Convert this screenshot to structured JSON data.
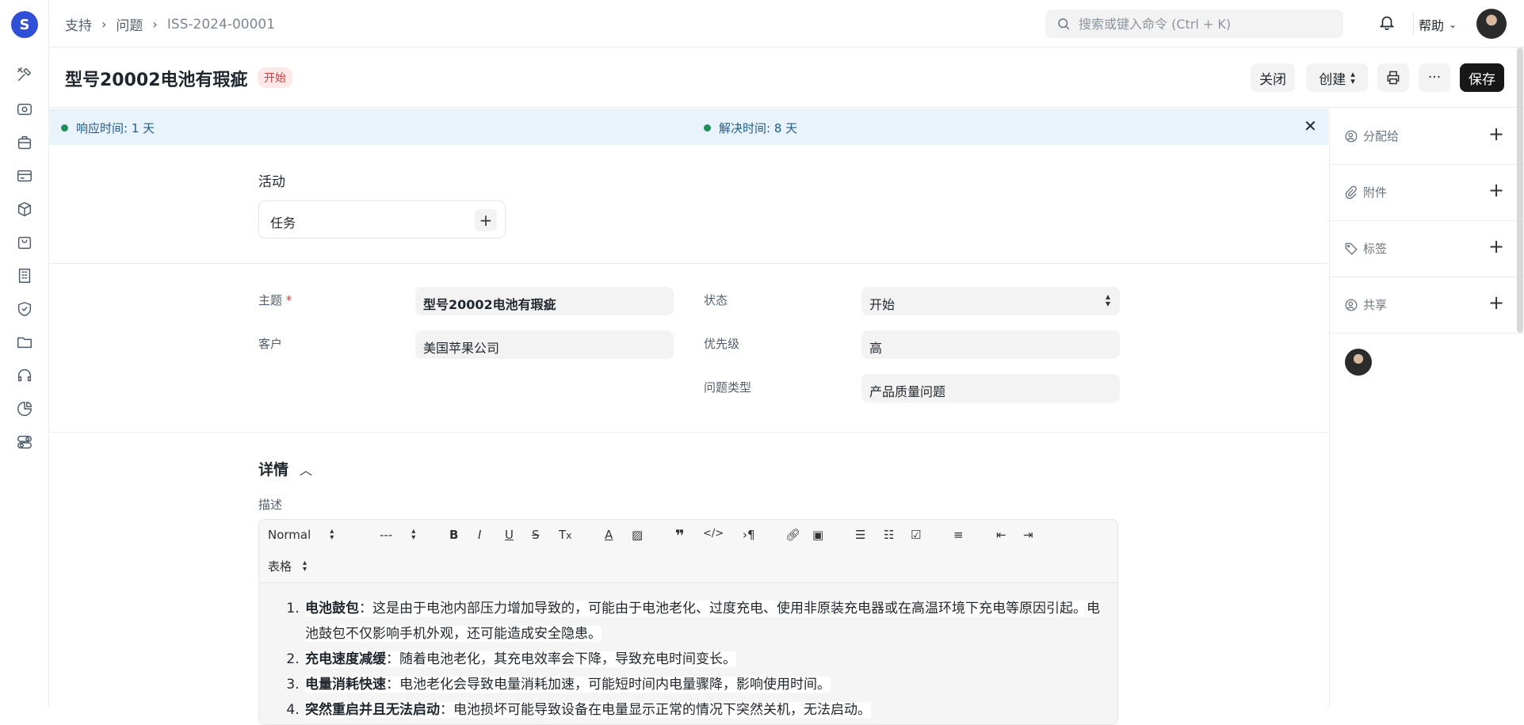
{
  "breadcrumb": [
    "支持",
    "问题",
    "ISS-2024-00001"
  ],
  "search": {
    "placeholder": "搜索或键入命令 (Ctrl + K)"
  },
  "help_label": "帮助",
  "page": {
    "title": "型号20002电池有瑕疵",
    "status": "开始"
  },
  "actions": {
    "close": "关闭",
    "create": "创建",
    "save": "保存",
    "more": "···"
  },
  "banner": {
    "response": "响应时间: 1 天",
    "resolution": "解决时间: 8 天"
  },
  "activity": {
    "heading": "活动",
    "task_label": "任务"
  },
  "form": {
    "subject_label": "主题",
    "subject_value": "型号20002电池有瑕疵",
    "customer_label": "客户",
    "customer_value": "美国苹果公司",
    "status_label": "状态",
    "status_value": "开始",
    "priority_label": "优先级",
    "priority_value": "高",
    "issue_type_label": "问题类型",
    "issue_type_value": "产品质量问题"
  },
  "details": {
    "title": "详情",
    "description_label": "描述",
    "toolbar": {
      "style": "Normal",
      "size": "---",
      "table": "表格"
    },
    "items": [
      {
        "term": "电池鼓包",
        "text": "：这是由于电池内部压力增加导致的，可能由于电池老化、过度充电、使用非原装充电器或在高温环境下充电等原因引起。电池鼓包不仅影响手机外观，还可能造成安全隐患。"
      },
      {
        "term": "充电速度减缓",
        "text": "：随着电池老化，其充电效率会下降，导致充电时间变长。"
      },
      {
        "term": "电量消耗快速",
        "text": "：电池老化会导致电量消耗加速，可能短时间内电量骤降，影响使用时间。"
      },
      {
        "term": "突然重启并且无法启动",
        "text": "：电池损坏可能导致设备在电量显示正常的情况下突然关机，无法启动。"
      }
    ]
  },
  "sidebar_right": {
    "assign": "分配给",
    "attachments": "附件",
    "tags": "标签",
    "share": "共享"
  }
}
